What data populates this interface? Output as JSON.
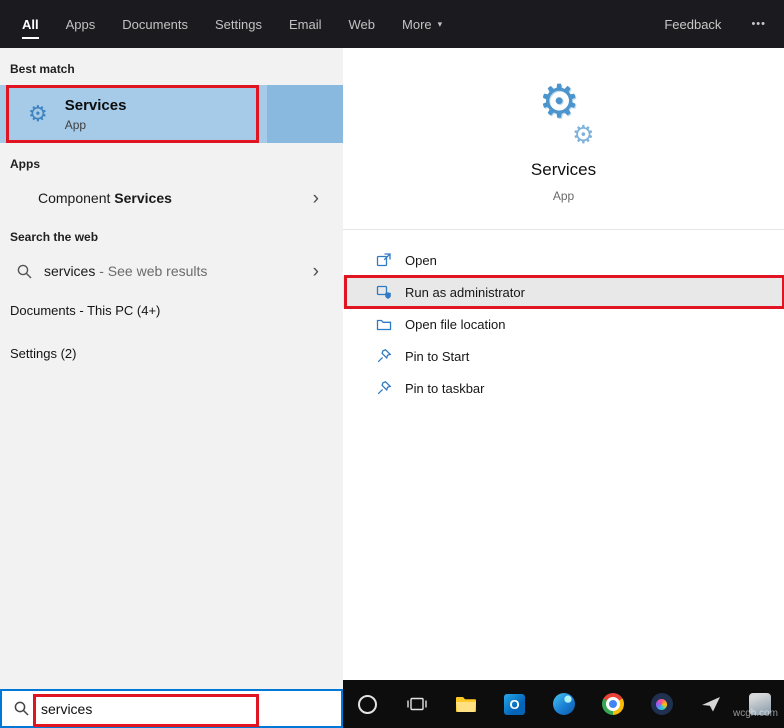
{
  "topbar": {
    "tabs": [
      {
        "label": "All"
      },
      {
        "label": "Apps"
      },
      {
        "label": "Documents"
      },
      {
        "label": "Settings"
      },
      {
        "label": "Email"
      },
      {
        "label": "Web"
      },
      {
        "label": "More"
      }
    ],
    "feedback": "Feedback",
    "overflow": "•••"
  },
  "left": {
    "best_match_header": "Best match",
    "best_match": {
      "title": "Services",
      "subtitle": "App"
    },
    "apps_header": "Apps",
    "component_services": {
      "prefix": "Component ",
      "match": "Services"
    },
    "search_web_header": "Search the web",
    "web_result": {
      "query": "services",
      "suffix": " - See web results"
    },
    "documents_header": "Documents - This PC (4+)",
    "settings_header": "Settings (2)"
  },
  "preview": {
    "title": "Services",
    "subtitle": "App",
    "actions": [
      {
        "label": "Open",
        "icon": "open-icon"
      },
      {
        "label": "Run as administrator",
        "icon": "run-admin-icon",
        "highlighted": true
      },
      {
        "label": "Open file location",
        "icon": "file-location-icon"
      },
      {
        "label": "Pin to Start",
        "icon": "pin-icon"
      },
      {
        "label": "Pin to taskbar",
        "icon": "pin-icon"
      }
    ]
  },
  "search": {
    "value": "services"
  },
  "taskbar": {
    "icons": [
      "cortana",
      "task-view",
      "file-explorer",
      "outlook",
      "edge",
      "chrome",
      "photos-app",
      "mail-plane",
      "clipped-app"
    ]
  },
  "watermark": "wcgh.com",
  "colors": {
    "accent": "#0078d7",
    "highlight": "#a6cbe8",
    "highlight-dark": "#8ab9e0",
    "annotation": "#e11422",
    "topbar-bg": "#1b1b1f",
    "panel-bg": "#f2f2f2",
    "taskbar-bg": "#0d0d0d"
  }
}
